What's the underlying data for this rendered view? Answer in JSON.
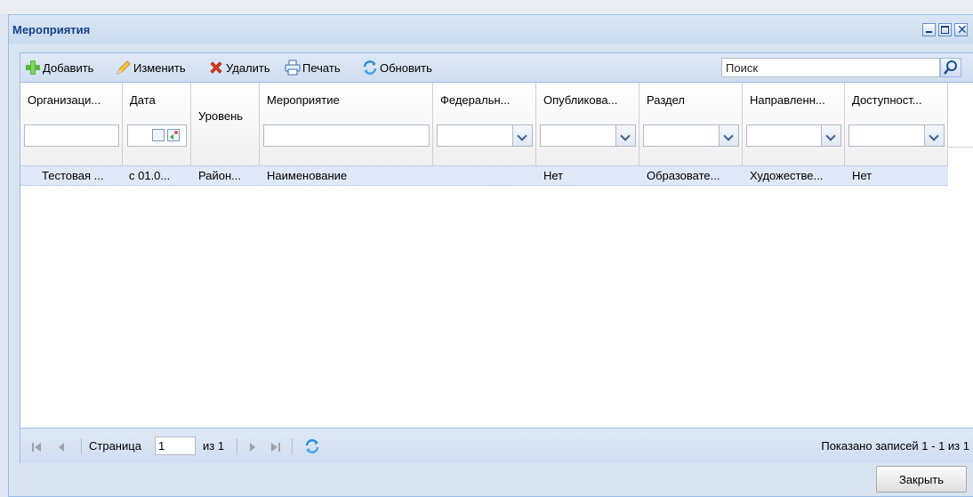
{
  "window": {
    "title": "Мероприятия"
  },
  "toolbar": {
    "add_label": "Добавить",
    "edit_label": "Изменить",
    "delete_label": "Удалить",
    "print_label": "Печать",
    "refresh_label": "Обновить",
    "search_placeholder": "Поиск"
  },
  "columns": [
    "Организаци...",
    "Дата",
    "Уровень",
    "Мероприятие",
    "Федеральн...",
    "Опубликова...",
    "Раздел",
    "Направленн...",
    "Доступност..."
  ],
  "rows": [
    {
      "organization": "Тестовая ...",
      "date": "с 01.0...",
      "level": "Район...",
      "event": "Наименование",
      "federal": "",
      "published": "Нет",
      "section": "Образовате...",
      "direction": "Художестве...",
      "availability": "Нет"
    }
  ],
  "pager": {
    "page_label": "Страница",
    "page_value": "1",
    "of_label": "из 1",
    "summary": "Показано записей 1 - 1 из 1"
  },
  "footer": {
    "close_label": "Закрыть"
  },
  "colors": {
    "header_text": "#15428b",
    "selected_row": "#dfe8f6",
    "border": "#99bbe8"
  },
  "icons": [
    "add-icon",
    "edit-icon",
    "delete-icon",
    "print-icon",
    "refresh-icon",
    "search-icon",
    "calendar-icon",
    "first-page-icon",
    "prev-page-icon",
    "next-page-icon",
    "last-page-icon"
  ]
}
